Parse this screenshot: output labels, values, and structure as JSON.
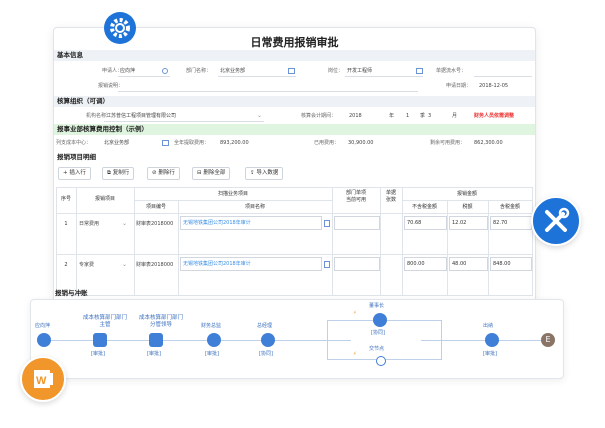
{
  "title": "日常费用报销审批",
  "sections": {
    "basic": "基本信息",
    "org": "核算组织（可调）",
    "budget": "报事业部核算费用控制（示例）",
    "detail": "报销项目明细",
    "flow": "报销与冲账"
  },
  "basic": {
    "applicant_label": "申请人：",
    "applicant": "应向萍",
    "dept_label": "部门名称：",
    "dept": "北京业务部",
    "post_label": "岗位：",
    "post": "开发工程师",
    "doc_label": "单据流水号：",
    "desc_label": "报销说明：",
    "date_label": "申请日期：",
    "date": "2018-12-05"
  },
  "org": {
    "name_label": "机构名称：",
    "name": "江苏普信工程项目管理有限公司",
    "period_label": "核算会计期间：",
    "year": "2018",
    "year_unit": "年",
    "quarter": "1",
    "quarter_unit": "季",
    "month": "3",
    "month_unit": "月",
    "warn": "财务人员依需调整"
  },
  "budget": {
    "center_label": "列支成本中心：",
    "center": "北京业务部",
    "total_label": "全年提取费用：",
    "total": "893,200.00",
    "used_label": "已用费用：",
    "used": "30,900.00",
    "remain_label": "剩余可用费用：",
    "remain": "862,300.00"
  },
  "toolbar": {
    "insert": "插入行",
    "copy": "复制行",
    "delete": "删除行",
    "clear": "删除全部",
    "import": "导入数据"
  },
  "table": {
    "headers": {
      "seq": "序号",
      "project": "报销项目",
      "group": "扫描业务项目",
      "code": "项目编号",
      "name": "项目名称",
      "dept_avail": "部门单项\n当前可用",
      "docs": "单据\n张数",
      "amount_group": "报销金额",
      "net": "不含税金额",
      "tax": "税额",
      "gross": "含税金额"
    },
    "rows": [
      {
        "seq": "1",
        "project": "日常费用",
        "code": "财审表2018000",
        "name": "无锡地铁集团公司2018年审计",
        "net": "70.68",
        "tax": "12.02",
        "gross": "82.70"
      },
      {
        "seq": "2",
        "project": "专家费",
        "code": "财审表2018000",
        "name": "无锡地铁集团公司2018年审计",
        "net": "800.00",
        "tax": "48.00",
        "gross": "848.00"
      }
    ]
  },
  "flow": {
    "nodes": [
      {
        "name": "应向萍",
        "tag": ""
      },
      {
        "name": "成本核算部门部门\n主管",
        "tag": "[审批]"
      },
      {
        "name": "成本核算部门部门\n分管领导",
        "tag": "[审批]"
      },
      {
        "name": "财务总监",
        "tag": "[审批]"
      },
      {
        "name": "总经理",
        "tag": "[协同]"
      },
      {
        "name": "董事长",
        "tag": "[协同]"
      },
      {
        "name": "交节点",
        "tag": ""
      },
      {
        "name": "出纳",
        "tag": "[审批]"
      }
    ],
    "end": "E"
  },
  "colors": {
    "brand": "#1e73d8",
    "warn": "#e33333",
    "office": "#f0962a",
    "section_green": "#dff5df"
  }
}
